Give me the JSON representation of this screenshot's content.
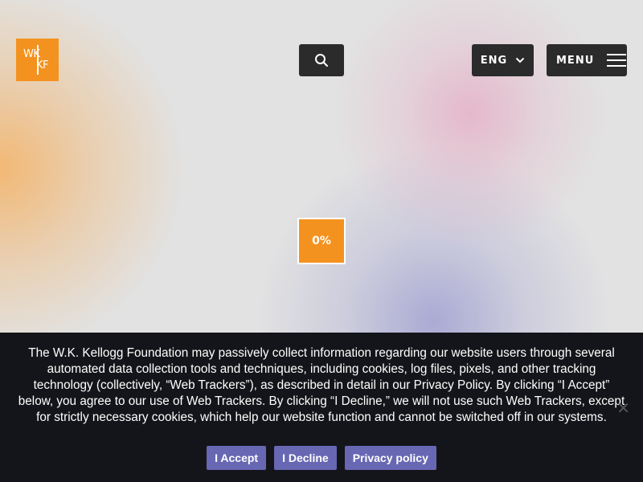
{
  "logo": {
    "text_wk": "WK",
    "text_kf": "KF",
    "icon": "wkkf-logo",
    "brand_color": "#f4921f"
  },
  "header": {
    "search_icon": "search-icon",
    "language": {
      "label": "ENG",
      "icon": "chevron-down-icon"
    },
    "menu": {
      "label": "MENU",
      "icon": "hamburger-icon"
    }
  },
  "loader": {
    "percent": "0%"
  },
  "cookie_banner": {
    "text": "The W.K. Kellogg Foundation may passively collect information regarding our website users through several automated data collection tools and techniques, including cookies, log files, pixels, and other tracking technology (collectively, “Web Trackers”), as described in detail in our Privacy Policy. By clicking “I Accept” below, you agree to our use of Web Trackers. By clicking “I Decline,” we will not use such Web Trackers, except for strictly necessary cookies, which help our website function and cannot be switched off in our systems.",
    "accept_label": "I Accept",
    "decline_label": "I Decline",
    "privacy_label": "Privacy policy",
    "close_symbol": "✕",
    "button_color": "#6767b3",
    "background_color": "#14151a"
  }
}
